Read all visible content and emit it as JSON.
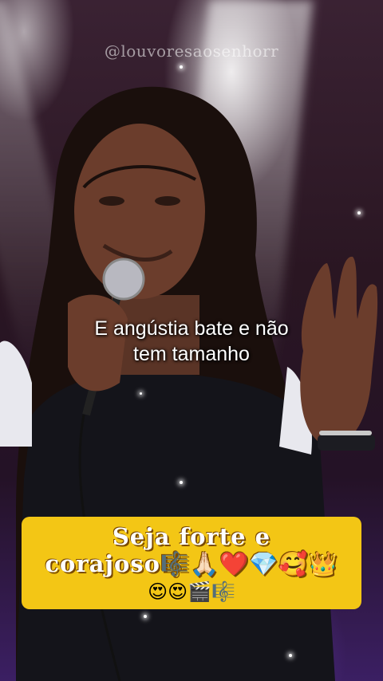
{
  "watermark": "@louvoresaosenhorr",
  "lyrics": {
    "line1": "E angústia bate e não",
    "line2": "tem tamanho"
  },
  "caption": {
    "line1": "Seja forte e",
    "line2": "corajoso🎼🙏🏻❤️💎🥰👑",
    "line3": "😍😍🎬🎼"
  },
  "colors": {
    "caption_background": "#f3c615",
    "caption_text": "#ffffff"
  }
}
